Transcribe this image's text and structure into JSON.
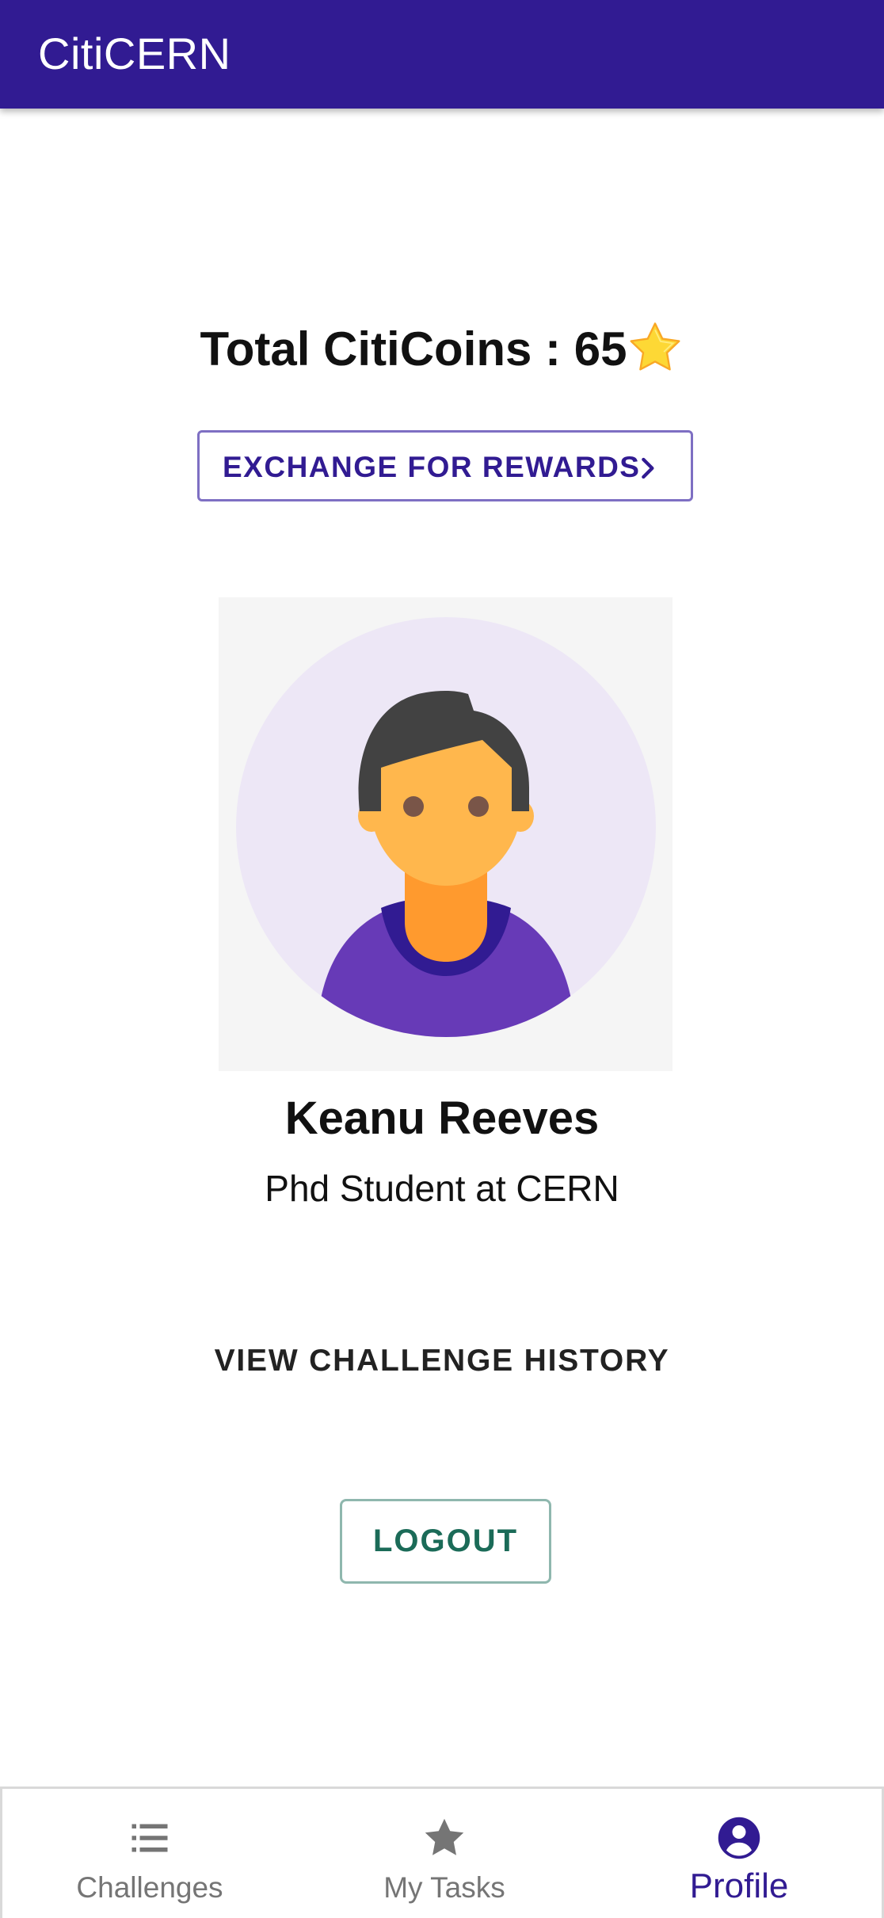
{
  "app_bar": {
    "title": "CitiCERN"
  },
  "coins": {
    "label": "Total CitiCoins : 65",
    "icon": "star-icon"
  },
  "exchange_button": {
    "label": "EXCHANGE FOR REWARDS",
    "icon": "chevron-right-icon"
  },
  "profile": {
    "avatar_icon": "user-avatar",
    "name": "Keanu Reeves",
    "role": "Phd Student at CERN"
  },
  "history_button": {
    "label": "VIEW CHALLENGE HISTORY"
  },
  "logout_button": {
    "label": "LOGOUT"
  },
  "bottom_nav": {
    "items": [
      {
        "label": "Challenges",
        "icon": "list-icon",
        "active": false
      },
      {
        "label": "My Tasks",
        "icon": "star-icon",
        "active": false
      },
      {
        "label": "Profile",
        "icon": "account-circle-icon",
        "active": true
      }
    ]
  },
  "colors": {
    "primary": "#311b92",
    "accent_text": "#1b6b58",
    "avatar_bg": "#ede7f6",
    "inactive_nav": "#757575"
  }
}
